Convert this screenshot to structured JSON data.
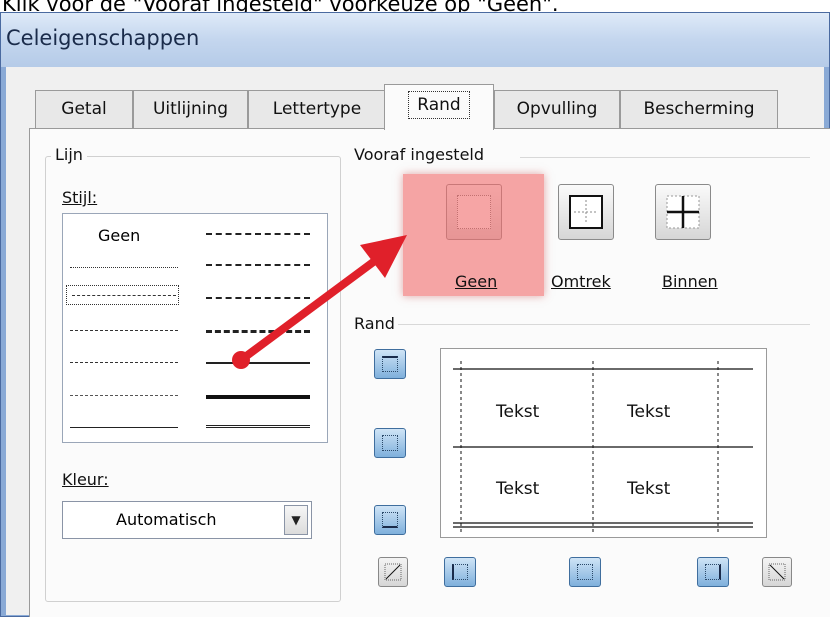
{
  "caption": "Klik voor de \"Vooraf ingesteld\" voorkeuze op \"Geen\".",
  "window": {
    "title": "Celeigenschappen"
  },
  "tabs": [
    {
      "label": "Getal"
    },
    {
      "label": "Uitlijning"
    },
    {
      "label": "Lettertype"
    },
    {
      "label": "Rand",
      "active": true
    },
    {
      "label": "Opvulling"
    },
    {
      "label": "Bescherming"
    }
  ],
  "line_group": {
    "legend": "Lijn",
    "style_label": "Stijl:",
    "style_none": "Geen",
    "color_label": "Kleur:",
    "color_value": "Automatisch"
  },
  "presets": {
    "legend": "Vooraf ingesteld",
    "items": [
      {
        "label": "Geen",
        "icon": "border-none-icon",
        "highlighted": true
      },
      {
        "label": "Omtrek",
        "icon": "border-outline-icon"
      },
      {
        "label": "Binnen",
        "icon": "border-inside-icon"
      }
    ]
  },
  "border_group": {
    "legend": "Rand",
    "preview_cells": [
      "Tekst",
      "Tekst",
      "Tekst",
      "Tekst"
    ]
  },
  "colors": {
    "highlight": "#f06e6e",
    "arrow": "#e0202a",
    "titlebar": "#c4d6ee",
    "blue_button": "#7fb0dc"
  }
}
